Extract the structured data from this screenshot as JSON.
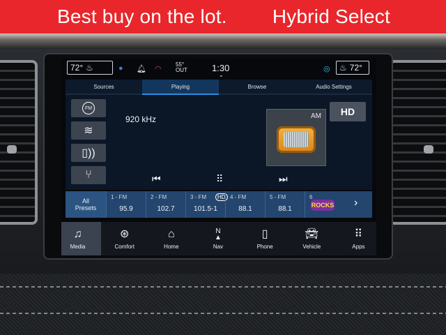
{
  "banner": {
    "left_text": "Best buy on the lot.",
    "right_text": "Hybrid Select"
  },
  "status": {
    "temp_left": "72°",
    "temp_right": "72°",
    "outside_temp": "55°",
    "outside_label": "OUT",
    "clock": "1:30"
  },
  "tabs": [
    {
      "label": "Sources",
      "active": false
    },
    {
      "label": "Playing",
      "active": true
    },
    {
      "label": "Browse",
      "active": false
    },
    {
      "label": "Audio Settings",
      "active": false
    }
  ],
  "player": {
    "source_fm": "FM",
    "frequency": "920 kHz",
    "band": "AM",
    "hd_label": "HD"
  },
  "presets": {
    "all_label_1": "All",
    "all_label_2": "Presets",
    "items": [
      {
        "label": "1 - FM",
        "value": "95.9"
      },
      {
        "label": "2 - FM",
        "value": "102.7"
      },
      {
        "label": "3 - FM",
        "value": "101.5-1"
      },
      {
        "label": "4 - FM",
        "value": "88.1"
      },
      {
        "label": "5 - FM",
        "value": "88.1"
      },
      {
        "label": "6",
        "value": "ROCKS"
      }
    ]
  },
  "bottom_nav": [
    {
      "label": "Media",
      "icon": "music-note-icon",
      "active": true
    },
    {
      "label": "Comfort",
      "icon": "comfort-icon",
      "active": false
    },
    {
      "label": "Home",
      "icon": "home-icon",
      "active": false
    },
    {
      "label": "Nav",
      "icon": "navigation-icon",
      "active": false
    },
    {
      "label": "Phone",
      "icon": "phone-icon",
      "active": false
    },
    {
      "label": "Vehicle",
      "icon": "vehicle-icon",
      "active": false
    },
    {
      "label": "Apps",
      "icon": "apps-grid-icon",
      "active": false
    }
  ],
  "colors": {
    "banner": "#e8262b",
    "screen_bg": "#0b1627",
    "accent": "#2d8ee0"
  }
}
